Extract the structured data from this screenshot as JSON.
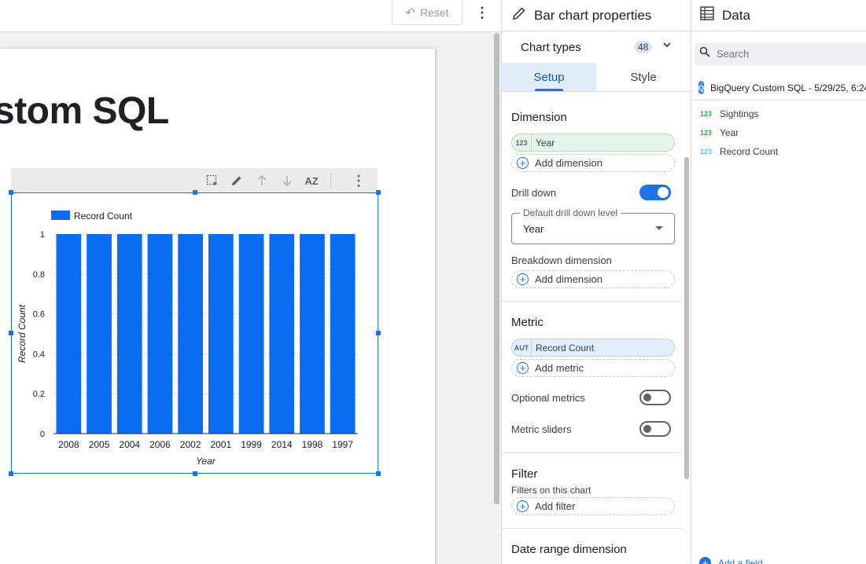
{
  "topbar": {
    "reset_label": "Reset"
  },
  "page": {
    "title": "stom SQL"
  },
  "chart_data": {
    "type": "bar",
    "categories": [
      "2008",
      "2005",
      "2004",
      "2006",
      "2002",
      "2001",
      "1999",
      "2014",
      "1998",
      "1997"
    ],
    "series": [
      {
        "name": "Record Count",
        "values": [
          1,
          1,
          1,
          1,
          1,
          1,
          1,
          1,
          1,
          1
        ]
      }
    ],
    "xlabel": "Year",
    "ylabel": "Record Count",
    "ylim": [
      0,
      1
    ],
    "yticks": [
      "0",
      "0.2",
      "0.4",
      "0.6",
      "0.8",
      "1"
    ],
    "legend": "top-left",
    "color": "#0a6cf1"
  },
  "props": {
    "header": "Bar chart properties",
    "chart_types_label": "Chart types",
    "chart_types_count": "48",
    "tabs": {
      "setup": "Setup",
      "style": "Style"
    },
    "dimension": {
      "title": "Dimension",
      "chip_type": "123",
      "chip_label": "Year",
      "add_label": "Add dimension",
      "drill_down_label": "Drill down",
      "drill_down_on": true,
      "drill_level_legend": "Default drill down level",
      "drill_level_value": "Year",
      "breakdown_label": "Breakdown dimension",
      "breakdown_add_label": "Add dimension"
    },
    "metric": {
      "title": "Metric",
      "chip_type": "AUT",
      "chip_label": "Record Count",
      "add_label": "Add metric",
      "optional_metrics_label": "Optional metrics",
      "optional_metrics_on": false,
      "metric_sliders_label": "Metric sliders",
      "metric_sliders_on": false
    },
    "filter": {
      "title": "Filter",
      "subtitle": "Filters on this chart",
      "add_label": "Add filter"
    },
    "date_range": {
      "title": "Date range dimension"
    }
  },
  "data": {
    "header": "Data",
    "search_placeholder": "Search",
    "datasource": "BigQuery Custom SQL - 5/29/25, 6:24...",
    "fields": [
      {
        "type": "123",
        "name": "Sightings",
        "color": "#34a853"
      },
      {
        "type": "123",
        "name": "Year",
        "color": "#34a853"
      },
      {
        "type": "123",
        "name": "Record Count",
        "color": "#4fc3f7"
      }
    ],
    "add_field_label": "Add a field"
  }
}
